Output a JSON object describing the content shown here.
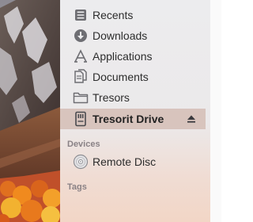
{
  "sidebar": {
    "favorites": [
      {
        "label": "Recents",
        "icon": "recents-icon"
      },
      {
        "label": "Downloads",
        "icon": "downloads-icon"
      },
      {
        "label": "Applications",
        "icon": "applications-icon"
      },
      {
        "label": "Documents",
        "icon": "documents-icon"
      },
      {
        "label": "Tresors",
        "icon": "folder-icon"
      },
      {
        "label": "Tresorit Drive",
        "icon": "tresorit-drive-icon",
        "selected": true,
        "eject_icon": "eject-icon"
      }
    ],
    "devices_header": "Devices",
    "devices": [
      {
        "label": "Remote Disc",
        "icon": "remote-disc-icon"
      }
    ],
    "tags_header": "Tags"
  },
  "colors": {
    "sidebar_background": "#ececee",
    "selection": "#d8c4bd",
    "section_header": "#8a8286",
    "icon_gray": "#6e6e73"
  }
}
